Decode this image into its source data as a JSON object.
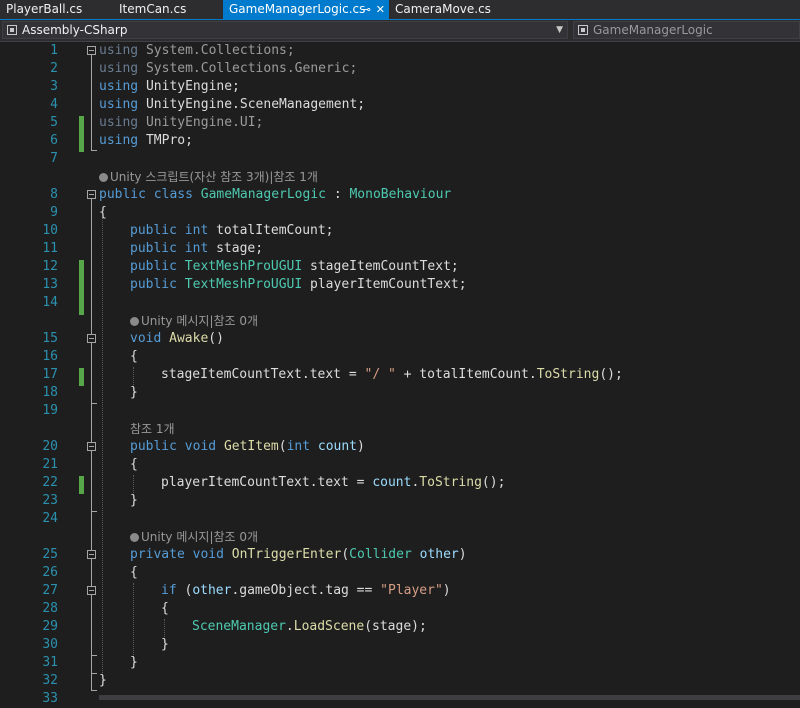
{
  "tabs": [
    {
      "label": "PlayerBall.cs",
      "active": false
    },
    {
      "label": "ItemCan.cs",
      "active": false
    },
    {
      "label": "GameManagerLogic.cs",
      "active": true,
      "pin_icon": "⊸",
      "close_icon": "✕"
    },
    {
      "label": "CameraMove.cs",
      "active": false
    }
  ],
  "navbar": {
    "project": "Assembly-CSharp",
    "class": "GameManagerLogic"
  },
  "lens": {
    "unity_script": "Unity 스크립트(자산 참조 3개)|참조 1개",
    "unity_message_awake": "Unity 메시지|참조 0개",
    "refs_getitem": "참조 1개",
    "unity_message_trigger": "Unity 메시지|참조 0개"
  },
  "line_numbers": [
    "1",
    "2",
    "3",
    "4",
    "5",
    "6",
    "7",
    "8",
    "9",
    "10",
    "11",
    "12",
    "13",
    "14",
    "15",
    "16",
    "17",
    "18",
    "19",
    "20",
    "21",
    "22",
    "23",
    "24",
    "25",
    "26",
    "27",
    "28",
    "29",
    "30",
    "31",
    "32",
    "33"
  ],
  "code": {
    "l1_kw": "using",
    "l1_ns": " System.Collections;",
    "l2_kw": "using",
    "l2_ns": " System.Collections.Generic;",
    "l3_kw": "using",
    "l3_ns": " UnityEngine;",
    "l4_kw": "using",
    "l4_ns": " UnityEngine.SceneManagement;",
    "l5_kw": "using",
    "l5_ns": " UnityEngine.UI;",
    "l6_kw": "using",
    "l6_ns": " TMPro;",
    "l8_public": "public",
    "l8_class": "class",
    "l8_name": "GameManagerLogic",
    "l8_colon": " : ",
    "l8_base": "MonoBehaviour",
    "l9": "{",
    "l10_public": "public",
    "l10_int": "int",
    "l10_rest": " totalItemCount;",
    "l11_public": "public",
    "l11_int": "int",
    "l11_rest": " stage;",
    "l12_public": "public",
    "l12_type": "TextMeshProUGUI",
    "l12_rest": " stageItemCountText;",
    "l13_public": "public",
    "l13_type": "TextMeshProUGUI",
    "l13_rest": " playerItemCountText;",
    "l15_void": "void",
    "l15_fn": "Awake",
    "l15_rest": "()",
    "l16": "{",
    "l17_a": "stageItemCountText.text = ",
    "l17_str": "\"/ \"",
    "l17_b": " + totalItemCount.",
    "l17_fn": "ToString",
    "l17_c": "();",
    "l18": "}",
    "l20_public": "public",
    "l20_void": "void",
    "l20_fn": "GetItem",
    "l20_open": "(",
    "l20_int": "int",
    "l20_param": "count",
    "l20_close": ")",
    "l21": "{",
    "l22_a": "playerItemCountText.text = ",
    "l22_param": "count",
    "l22_b": ".",
    "l22_fn": "ToString",
    "l22_c": "();",
    "l23": "}",
    "l25_private": "private",
    "l25_void": "void",
    "l25_fn": "OnTriggerEnter",
    "l25_open": "(",
    "l25_type": "Collider",
    "l25_param": "other",
    "l25_close": ")",
    "l26": "{",
    "l27_if": "if",
    "l27_open": " (",
    "l27_param": "other",
    "l27_rest": ".gameObject.tag == ",
    "l27_str": "\"Player\"",
    "l27_close": ")",
    "l28": "{",
    "l29_type": "SceneManager",
    "l29_dot": ".",
    "l29_fn": "LoadScene",
    "l29_rest": "(stage);",
    "l30": "}",
    "l31": "}",
    "l32": "}"
  },
  "colors": {
    "keyword": "#569cd6",
    "type": "#4ec9b0",
    "function": "#dcdcaa",
    "string": "#d69d85",
    "parameter": "#9cdcfe",
    "line_number": "#2b91af",
    "change_marker": "#57a64a",
    "accent": "#007acc"
  }
}
